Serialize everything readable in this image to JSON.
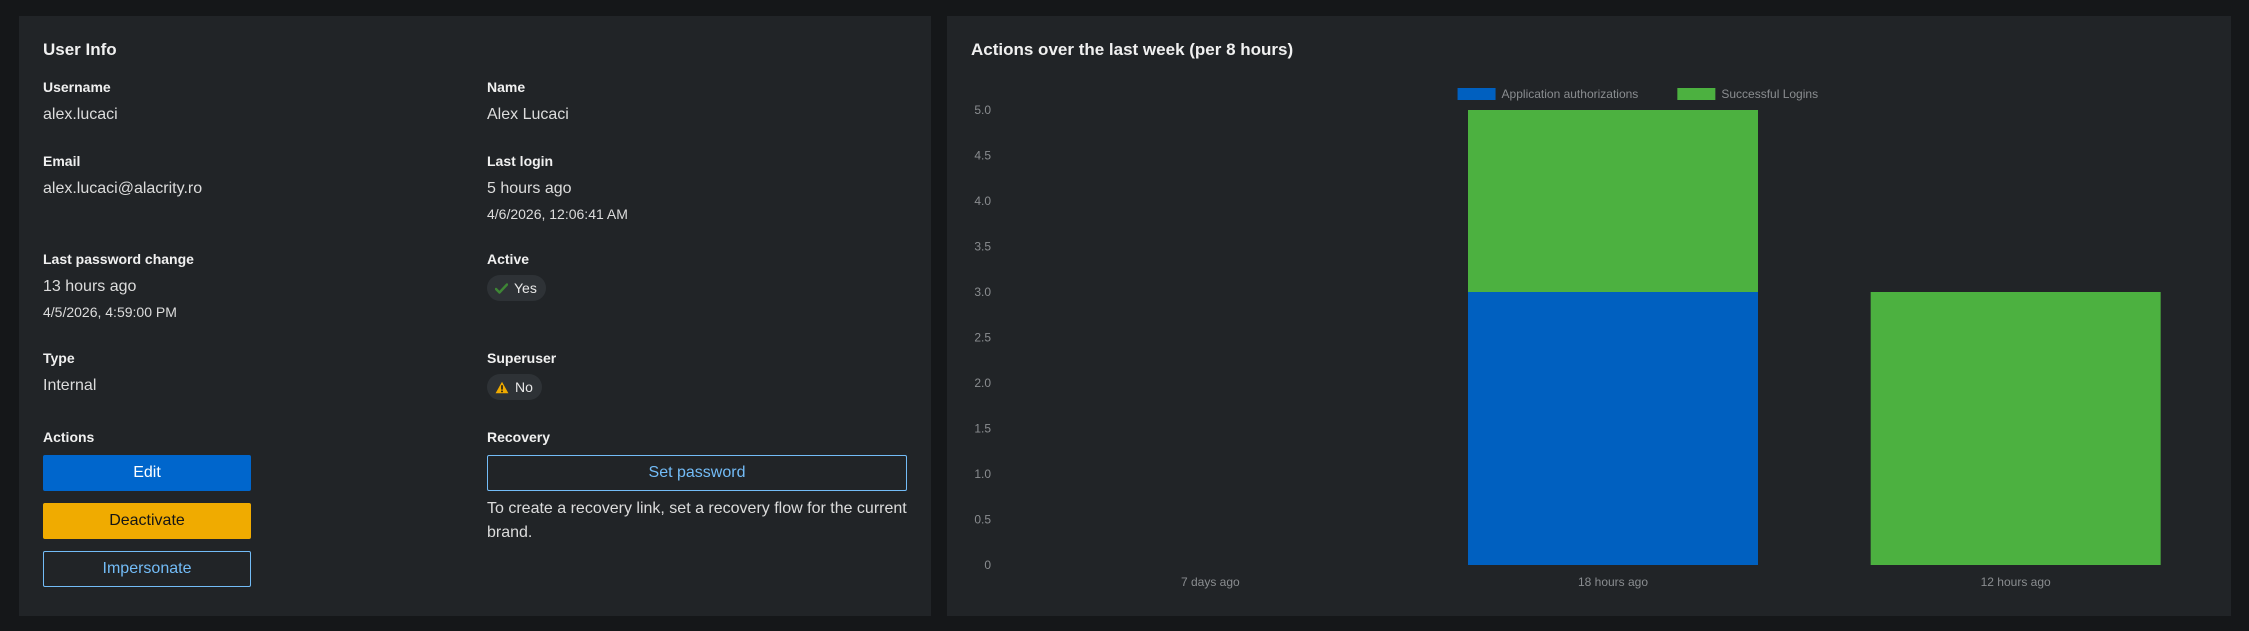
{
  "user_info": {
    "title": "User Info",
    "username": {
      "label": "Username",
      "value": "alex.lucaci"
    },
    "name": {
      "label": "Name",
      "value": "Alex Lucaci"
    },
    "email": {
      "label": "Email",
      "value": "alex.lucaci@alacrity.ro"
    },
    "last_login": {
      "label": "Last login",
      "relative": "5 hours ago",
      "absolute": "4/6/2026, 12:06:41 AM"
    },
    "last_password_change": {
      "label": "Last password change",
      "relative": "13 hours ago",
      "absolute": "4/5/2026, 4:59:00 PM"
    },
    "active": {
      "label": "Active",
      "value": "Yes",
      "icon": "check-icon",
      "color": "#3e8635"
    },
    "type": {
      "label": "Type",
      "value": "Internal"
    },
    "superuser": {
      "label": "Superuser",
      "value": "No",
      "icon": "warning-icon",
      "color": "#f0ab00"
    },
    "actions": {
      "label": "Actions",
      "edit": "Edit",
      "deactivate": "Deactivate",
      "impersonate": "Impersonate"
    },
    "recovery": {
      "label": "Recovery",
      "set_password": "Set password",
      "text": "To create a recovery link, set a recovery flow for the current brand."
    }
  },
  "chart": {
    "title": "Actions over the last week (per 8 hours)"
  },
  "colors": {
    "primary": "#0066cc",
    "warning": "#f0ab00",
    "link": "#73bcf7",
    "success": "#3e8635"
  },
  "chart_data": {
    "type": "bar",
    "stacked": true,
    "categories": [
      "7 days ago",
      "18 hours ago",
      "12 hours ago"
    ],
    "series": [
      {
        "name": "Application authorizations",
        "color": "#0060c0",
        "values": [
          0,
          3,
          0
        ]
      },
      {
        "name": "Successful Logins",
        "color": "#4cb140",
        "values": [
          0,
          2,
          3
        ]
      }
    ],
    "ylim": [
      0,
      5
    ],
    "yticks": [
      "0",
      "0.5",
      "1.0",
      "1.5",
      "2.0",
      "2.5",
      "3.0",
      "3.5",
      "4.0",
      "4.5",
      "5.0"
    ],
    "legend": "top-center",
    "grid": false
  }
}
